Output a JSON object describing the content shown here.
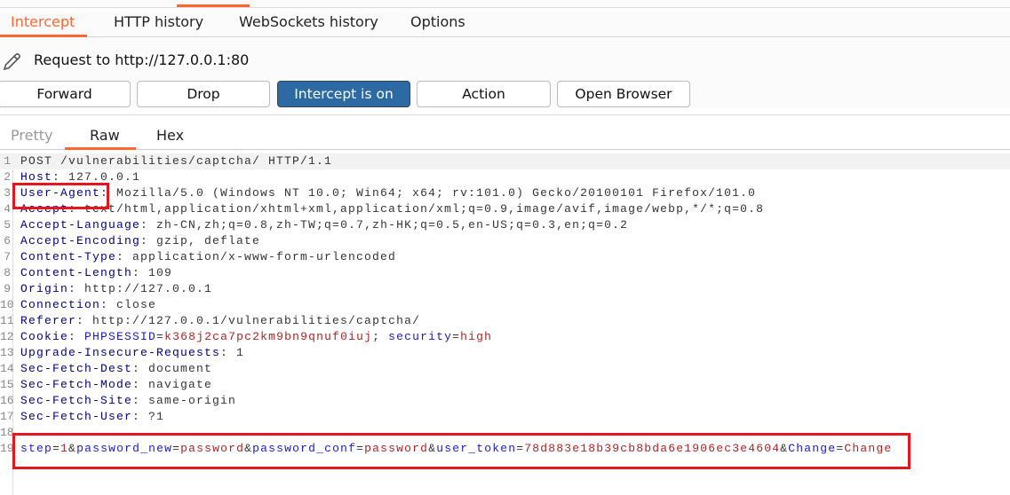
{
  "tabs": [
    {
      "label": "Intercept",
      "active": true
    },
    {
      "label": "HTTP history"
    },
    {
      "label": "WebSockets history"
    },
    {
      "label": "Options"
    }
  ],
  "request": {
    "label": "Request to http://127.0.0.1:80",
    "icon": "pencil-icon"
  },
  "buttons": {
    "forward": "Forward",
    "drop": "Drop",
    "intercept": "Intercept is on",
    "action": "Action",
    "open_browser": "Open Browser"
  },
  "subtabs": [
    {
      "label": "Pretty"
    },
    {
      "label": "Raw",
      "active": true
    },
    {
      "label": "Hex"
    }
  ],
  "colors": {
    "accent": "#ff6633",
    "intercept_on": "#2d6aa3",
    "key": "#000080",
    "val": "#333333",
    "red": "#b22222",
    "param": "#1a1acc",
    "highlight_box": "#e8141e"
  },
  "lines": [
    [
      {
        "t": "POST /vulnerabilities/captcha/ HTTP/1.1",
        "c": "val"
      }
    ],
    [
      {
        "t": "Host",
        "c": "key"
      },
      {
        "t": ": 127.0.0.1",
        "c": "val"
      }
    ],
    [
      {
        "t": "User-Agent",
        "c": "key"
      },
      {
        "t": ": Mozilla/5.0 (Windows NT 10.0; Win64; x64; rv:101.0) Gecko/20100101 Firefox/101.0",
        "c": "val"
      }
    ],
    [
      {
        "t": "Accept",
        "c": "key"
      },
      {
        "t": ": text/html,application/xhtml+xml,application/xml;q=0.9,image/avif,image/webp,*/*;q=0.8",
        "c": "val"
      }
    ],
    [
      {
        "t": "Accept-Language",
        "c": "key"
      },
      {
        "t": ": zh-CN,zh;q=0.8,zh-TW;q=0.7,zh-HK;q=0.5,en-US;q=0.3,en;q=0.2",
        "c": "val"
      }
    ],
    [
      {
        "t": "Accept-Encoding",
        "c": "key"
      },
      {
        "t": ": gzip, deflate",
        "c": "val"
      }
    ],
    [
      {
        "t": "Content-Type",
        "c": "key"
      },
      {
        "t": ": application/x-www-form-urlencoded",
        "c": "val"
      }
    ],
    [
      {
        "t": "Content-Length",
        "c": "key"
      },
      {
        "t": ": 109",
        "c": "val"
      }
    ],
    [
      {
        "t": "Origin",
        "c": "key"
      },
      {
        "t": ": http://127.0.0.1",
        "c": "val"
      }
    ],
    [
      {
        "t": "Connection",
        "c": "key"
      },
      {
        "t": ": close",
        "c": "val"
      }
    ],
    [
      {
        "t": "Referer",
        "c": "key"
      },
      {
        "t": ": http://127.0.0.1/vulnerabilities/captcha/",
        "c": "val"
      }
    ],
    [
      {
        "t": "Cookie",
        "c": "key"
      },
      {
        "t": ": ",
        "c": "val"
      },
      {
        "t": "PHPSESSID",
        "c": "param"
      },
      {
        "t": "=",
        "c": "val"
      },
      {
        "t": "k368j2ca7pc2km9bn9qnuf0iuj",
        "c": "red"
      },
      {
        "t": "; ",
        "c": "val"
      },
      {
        "t": "security",
        "c": "param"
      },
      {
        "t": "=",
        "c": "val"
      },
      {
        "t": "high",
        "c": "red"
      }
    ],
    [
      {
        "t": "Upgrade-Insecure-Requests",
        "c": "key"
      },
      {
        "t": ": 1",
        "c": "val"
      }
    ],
    [
      {
        "t": "Sec-Fetch-Dest",
        "c": "key"
      },
      {
        "t": ": document",
        "c": "val"
      }
    ],
    [
      {
        "t": "Sec-Fetch-Mode",
        "c": "key"
      },
      {
        "t": ": navigate",
        "c": "val"
      }
    ],
    [
      {
        "t": "Sec-Fetch-Site",
        "c": "key"
      },
      {
        "t": ": same-origin",
        "c": "val"
      }
    ],
    [
      {
        "t": "Sec-Fetch-User",
        "c": "key"
      },
      {
        "t": ": ?1",
        "c": "val"
      }
    ],
    [],
    [
      {
        "t": "step",
        "c": "param"
      },
      {
        "t": "=",
        "c": "val"
      },
      {
        "t": "1",
        "c": "red"
      },
      {
        "t": "&",
        "c": "val"
      },
      {
        "t": "password_new",
        "c": "param"
      },
      {
        "t": "=",
        "c": "val"
      },
      {
        "t": "password",
        "c": "red"
      },
      {
        "t": "&",
        "c": "val"
      },
      {
        "t": "password_conf",
        "c": "param"
      },
      {
        "t": "=",
        "c": "val"
      },
      {
        "t": "password",
        "c": "red"
      },
      {
        "t": "&",
        "c": "val"
      },
      {
        "t": "user_token",
        "c": "param"
      },
      {
        "t": "=",
        "c": "val"
      },
      {
        "t": "78d883e18b39cb8bda6e1906ec3e4604",
        "c": "red"
      },
      {
        "t": "&",
        "c": "val"
      },
      {
        "t": "Change",
        "c": "param"
      },
      {
        "t": "=",
        "c": "val"
      },
      {
        "t": "Change",
        "c": "red"
      }
    ]
  ]
}
